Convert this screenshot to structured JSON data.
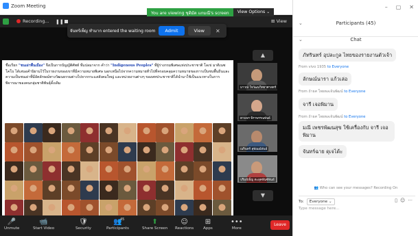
{
  "window": {
    "app_title": "Zoom Meeting"
  },
  "share_banner": {
    "status": "You are viewing ชุติมัต แกมณี's screen",
    "options": "View Options ⌄"
  },
  "topbar": {
    "recording": "Recording...",
    "view": "View"
  },
  "waiting_room": {
    "message": "จันทร์เพ็ญ ทำมาก entered the waiting room",
    "admit": "Admit",
    "view": "View"
  },
  "slide": {
    "intro": "ชื่อเรียก ",
    "term_th": "\"ชนเผ่าพื้นเมือง\"",
    "mid": " จึงเป็นการบัญญัติศัพท์ ที่แปลมาจาก คำว่า ",
    "term_en": "\"Indigenous Peoples\"",
    "body": " ที่ผู้ร่างกรมพิเศษแห่งประชาชาติ โลเข่ มาติเนซ โคโบ ได้เสนอคำนิยามไว้ในรายงานของเขาที่มีความหมายพิเศษ นอกเหนือไปจากความหมายทั่วไปที่ครอบคลุมความหมายของการเป็นชนพื้นถิ่นและความเป็นชนเผ่าที่มีอัตลักษณ์ทางวัฒนธรรมต่างไปจากกระแสสังคมใหญ่ และหน่วยงานต่างๆ ของสหประชาชาติได้นำมาใช้เป็นแนวทางในการพิจารณาของคนกลุ่มชาติพันธุ์ดั้งเดิม"
  },
  "gallery": [
    {
      "name": "มาวณ์ ใจวัฒนวิทยาศาสตร์"
    },
    {
      "name": "ตามพร พิราพรรณพันธ์"
    },
    {
      "name": "ณรินทร์ สุพัณณ์พันธ์"
    },
    {
      "name": "ปริมย์เพ็ญ ตะลุคฟันซ์พันธ์"
    }
  ],
  "toolbar": [
    {
      "label": "Unmute",
      "icon": "🎤"
    },
    {
      "label": "Start Video",
      "icon": "📹"
    },
    {
      "label": "Security",
      "icon": "🛡"
    },
    {
      "label": "Participants",
      "icon": "👥",
      "badge": "45"
    },
    {
      "label": "Share Screen",
      "icon": "⬆"
    },
    {
      "label": "Reactions",
      "icon": "☺"
    },
    {
      "label": "Apps",
      "icon": "⊞"
    },
    {
      "label": "More",
      "icon": "•••"
    }
  ],
  "leave": "Leave",
  "panel": {
    "participants_title": "Participants (45)",
    "chat_title": "Chat",
    "messages": [
      {
        "text": "ภัทรินทร์ อุปละกูล ไทยของรายงานตัวเจ้า"
      },
      {
        "from": "From vivo 1935",
        "to": "to Everyone",
        "text": "ลักษณ์นารา แก้วเล่อ"
      },
      {
        "from": "From ถ้ายศ โพธพลเจ้นพัฒน์",
        "to": "to Everyone",
        "text": "จารี เจอพิมาน"
      },
      {
        "from": "From ถ้ายศ โพธพลเจ้นพัฒน์",
        "to": "to Everyone",
        "text": "มณี เพชรพัฒนสุข ใช้เครื่องกับ จารี เจอพิมาน"
      },
      {
        "text": "จันทร์ฉาย ดุเจได้ะ"
      }
    ],
    "who_can_see": "Who can see your messages? Recording On",
    "to_label": "To:",
    "to_value": "Everyone",
    "placeholder": "Type message here..."
  }
}
